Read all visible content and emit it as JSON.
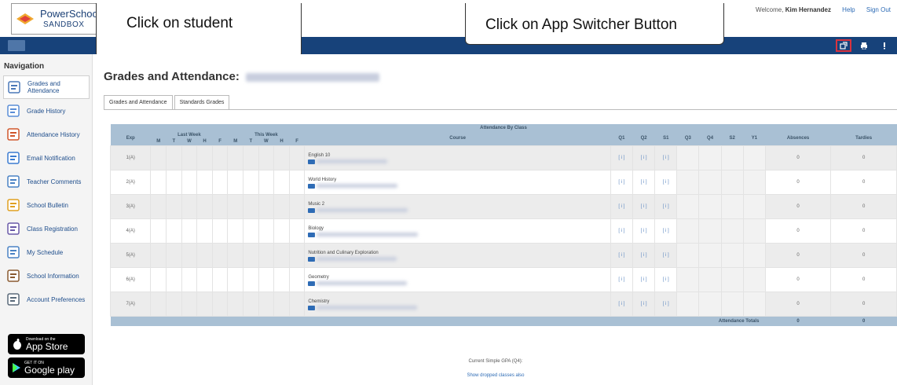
{
  "logo": {
    "line1": "PowerSchool",
    "line2": "SANDBOX"
  },
  "header": {
    "welcome_prefix": "Welcome,",
    "user_name": "Kim Hernandez",
    "help_link": "Help",
    "signout_link": "Sign Out"
  },
  "callouts": {
    "student": "Click on student",
    "app_switcher": "Click on App Switcher Button"
  },
  "nav_icons": [
    "app-switcher-icon",
    "print-icon",
    "alert-icon"
  ],
  "sidebar": {
    "title": "Navigation",
    "items": [
      {
        "label": "Grades and Attendance",
        "icon": "grades-attendance-icon",
        "active": true
      },
      {
        "label": "Grade History",
        "icon": "grade-history-icon"
      },
      {
        "label": "Attendance History",
        "icon": "attendance-history-icon"
      },
      {
        "label": "Email Notification",
        "icon": "email-notification-icon"
      },
      {
        "label": "Teacher Comments",
        "icon": "teacher-comments-icon"
      },
      {
        "label": "School Bulletin",
        "icon": "school-bulletin-icon"
      },
      {
        "label": "Class Registration",
        "icon": "class-registration-icon"
      },
      {
        "label": "My Schedule",
        "icon": "my-schedule-icon"
      },
      {
        "label": "School Information",
        "icon": "school-information-icon"
      },
      {
        "label": "Account Preferences",
        "icon": "account-preferences-icon"
      }
    ],
    "app_store": {
      "small": "Download on the",
      "big": "App Store"
    },
    "google_play": {
      "small": "GET IT ON",
      "big": "Google play"
    }
  },
  "main": {
    "title": "Grades and Attendance:",
    "tabs": [
      "Grades and Attendance",
      "Standards Grades"
    ]
  },
  "attendance": {
    "title": "Attendance By Class",
    "col_exp": "Exp",
    "last_week": "Last Week",
    "this_week": "This Week",
    "days": [
      "M",
      "T",
      "W",
      "H",
      "F"
    ],
    "col_course": "Course",
    "terms": [
      "Q1",
      "Q2",
      "S1",
      "Q3",
      "Q4",
      "S2",
      "Y1"
    ],
    "col_absences": "Absences",
    "col_tardies": "Tardies",
    "rows": [
      {
        "exp": "1(A)",
        "course": "English 10",
        "grades": [
          "[ i ]",
          "[ i ]",
          "[ i ]"
        ],
        "absences": "0",
        "tardies": "0"
      },
      {
        "exp": "2(A)",
        "course": "World History",
        "grades": [
          "[ i ]",
          "[ i ]",
          "[ i ]"
        ],
        "absences": "0",
        "tardies": "0"
      },
      {
        "exp": "3(A)",
        "course": "Music 2",
        "grades": [
          "[ i ]",
          "[ i ]",
          "[ i ]"
        ],
        "absences": "0",
        "tardies": "0"
      },
      {
        "exp": "4(A)",
        "course": "Biology",
        "grades": [
          "[ i ]",
          "[ i ]",
          "[ i ]"
        ],
        "absences": "0",
        "tardies": "0"
      },
      {
        "exp": "5(A)",
        "course": "Nutrition and Culinary Exploration",
        "grades": [
          "[ i ]",
          "[ i ]",
          "[ i ]"
        ],
        "absences": "0",
        "tardies": "0"
      },
      {
        "exp": "6(A)",
        "course": "Geometry",
        "grades": [
          "[ i ]",
          "[ i ]",
          "[ i ]"
        ],
        "absences": "0",
        "tardies": "0"
      },
      {
        "exp": "7(A)",
        "course": "Chemistry",
        "grades": [
          "[ i ]",
          "[ i ]",
          "[ i ]"
        ],
        "absences": "0",
        "tardies": "0"
      }
    ],
    "totals_label": "Attendance Totals",
    "totals_absences": "0",
    "totals_tardies": "0"
  },
  "gpa_label": "Current Simple GPA (Q4):",
  "dropped_link": "Show dropped classes also",
  "colors": {
    "nav_bar": "#17427a",
    "table_header": "#a9c0d4",
    "link": "#2d6bb5",
    "highlight": "#d9333f"
  }
}
